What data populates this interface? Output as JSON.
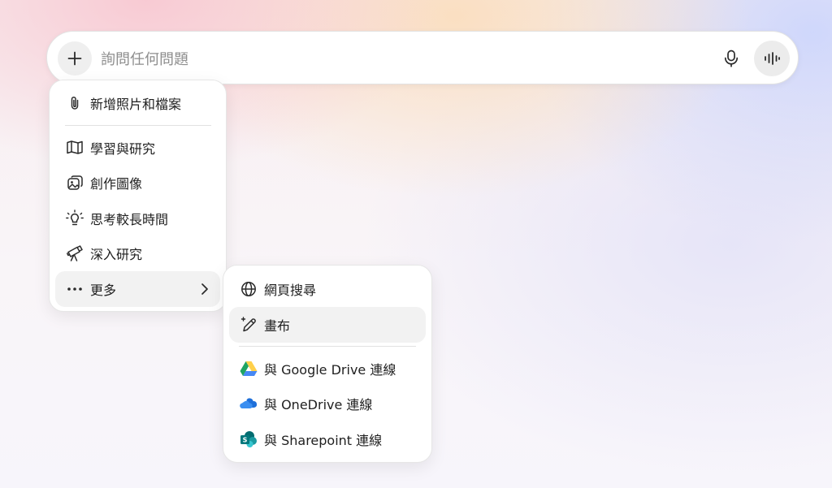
{
  "search": {
    "placeholder": "詢問任何問題",
    "add_icon": "plus-icon",
    "mic_icon": "microphone-icon",
    "voice_icon": "voice-waveform-icon"
  },
  "menu_primary": {
    "items": [
      {
        "label": "新增照片和檔案",
        "icon": "paperclip-icon"
      },
      {
        "label": "學習與研究",
        "icon": "book-open-icon"
      },
      {
        "label": "創作圖像",
        "icon": "image-icon"
      },
      {
        "label": "思考較長時間",
        "icon": "lightbulb-icon"
      },
      {
        "label": "深入研究",
        "icon": "telescope-icon"
      },
      {
        "label": "更多",
        "icon": "more-dots-icon",
        "chevron": "chevron-right-icon"
      }
    ]
  },
  "menu_secondary": {
    "items": [
      {
        "label": "網頁搜尋",
        "icon": "globe-icon"
      },
      {
        "label": "畫布",
        "icon": "pen-sparkle-icon"
      },
      {
        "label": "與 Google Drive 連線",
        "icon": "google-drive-icon"
      },
      {
        "label": "與 OneDrive 連線",
        "icon": "onedrive-icon"
      },
      {
        "label": "與 Sharepoint 連線",
        "icon": "sharepoint-icon"
      }
    ]
  },
  "colors": {
    "gdrive_green": "#1fa463",
    "gdrive_yellow": "#ffd04b",
    "gdrive_blue": "#4688f4",
    "onedrive_blue": "#1e6fd9",
    "sharepoint_teal": "#038387"
  }
}
